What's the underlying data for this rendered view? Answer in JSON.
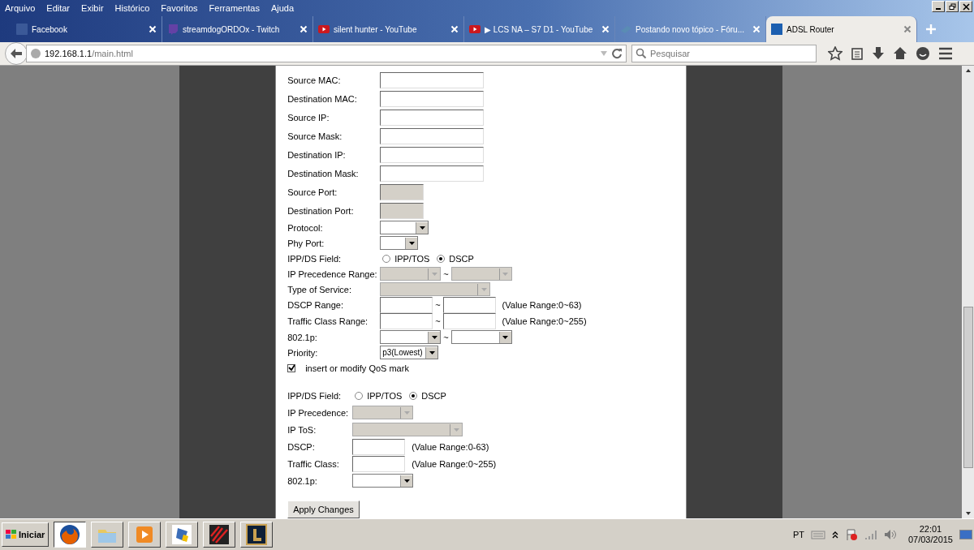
{
  "menu": [
    "Arquivo",
    "Editar",
    "Exibir",
    "Histórico",
    "Favoritos",
    "Ferramentas",
    "Ajuda"
  ],
  "tabs": [
    {
      "title": "Facebook",
      "selected": false
    },
    {
      "title": "streamdogORDOx - Twitch",
      "selected": false
    },
    {
      "title": "silent hunter - YouTube",
      "selected": false
    },
    {
      "title": "▶ LCS NA – S7 D1 - YouTube",
      "selected": false
    },
    {
      "title": "Postando novo tópico - Fóru...",
      "selected": false
    },
    {
      "title": "ADSL Router",
      "selected": true
    }
  ],
  "address": {
    "host": "192.168.1.1",
    "path": "/main.html"
  },
  "search": {
    "placeholder": "Pesquisar"
  },
  "sections": [
    {
      "rows": [
        {
          "kind": "controls",
          "label": "Source MAC:",
          "controls": [
            {
              "kind": "input",
              "disabled": false
            }
          ]
        },
        {
          "kind": "controls",
          "label": "Destination MAC:",
          "controls": [
            {
              "kind": "input",
              "disabled": false
            }
          ]
        },
        {
          "kind": "controls",
          "label": "Source IP:",
          "controls": [
            {
              "kind": "input",
              "disabled": false
            }
          ]
        },
        {
          "kind": "controls",
          "label": "Source Mask:",
          "controls": [
            {
              "kind": "input",
              "disabled": false
            }
          ]
        },
        {
          "kind": "controls",
          "label": "Destination IP:",
          "controls": [
            {
              "kind": "input",
              "disabled": false
            }
          ]
        },
        {
          "kind": "controls",
          "label": "Destination Mask:",
          "controls": [
            {
              "kind": "input",
              "disabled": false
            }
          ]
        },
        {
          "kind": "controls",
          "label": "Source Port:",
          "controls": [
            {
              "kind": "input",
              "disabled": true
            }
          ]
        },
        {
          "kind": "controls",
          "label": "Destination Port:",
          "controls": [
            {
              "kind": "input",
              "disabled": true
            }
          ]
        },
        {
          "kind": "controls",
          "label": "Protocol:",
          "controls": [
            {
              "kind": "select",
              "disabled": false
            }
          ]
        },
        {
          "kind": "controls",
          "label": "Phy Port:",
          "controls": [
            {
              "kind": "select",
              "disabled": false
            }
          ]
        },
        {
          "kind": "radio",
          "label": "IPP/DS Field:",
          "options": [
            {
              "label": "IPP/TOS",
              "selected": false
            },
            {
              "label": "DSCP",
              "selected": true
            }
          ]
        },
        {
          "kind": "controls",
          "label": "IP Precedence Range:",
          "separator": "~",
          "controls": [
            {
              "kind": "select",
              "disabled": true
            },
            {
              "kind": "select",
              "disabled": true
            }
          ]
        },
        {
          "kind": "controls",
          "label": "Type of Service:",
          "controls": [
            {
              "kind": "select",
              "disabled": true
            }
          ]
        },
        {
          "kind": "controls",
          "label": "DSCP Range:",
          "separator": "~",
          "hint": "(Value Range:0~63)",
          "controls": [
            {
              "kind": "input",
              "disabled": false
            },
            {
              "kind": "input",
              "disabled": false
            }
          ]
        },
        {
          "kind": "controls",
          "label": "Traffic Class Range:",
          "separator": "~",
          "hint": "(Value Range:0~255)",
          "controls": [
            {
              "kind": "input",
              "disabled": false
            },
            {
              "kind": "input",
              "disabled": false
            }
          ]
        },
        {
          "kind": "controls",
          "label": "802.1p:",
          "separator": "~",
          "controls": [
            {
              "kind": "select",
              "disabled": false
            },
            {
              "kind": "select",
              "disabled": false
            }
          ]
        },
        {
          "kind": "controls",
          "label": "Priority:",
          "controls": [
            {
              "kind": "select",
              "disabled": false,
              "value": "p3(Lowest)"
            }
          ]
        },
        {
          "kind": "checkbox",
          "label": "insert or modify QoS mark",
          "checked": true
        }
      ]
    },
    {
      "rows": [
        {
          "kind": "radio",
          "label": "IPP/DS Field:",
          "options": [
            {
              "label": "IPP/TOS",
              "selected": false
            },
            {
              "label": "DSCP",
              "selected": true
            }
          ]
        },
        {
          "kind": "controls",
          "label": "IP Precedence:",
          "controls": [
            {
              "kind": "select",
              "disabled": true
            }
          ]
        },
        {
          "kind": "controls",
          "label": "IP ToS:",
          "controls": [
            {
              "kind": "select",
              "disabled": true
            }
          ]
        },
        {
          "kind": "controls",
          "label": "DSCP:",
          "hint": "(Value Range:0-63)",
          "controls": [
            {
              "kind": "input",
              "disabled": false
            }
          ]
        },
        {
          "kind": "controls",
          "label": "Traffic Class:",
          "hint": "(Value Range:0~255)",
          "controls": [
            {
              "kind": "input",
              "disabled": false
            }
          ]
        },
        {
          "kind": "controls",
          "label": "802.1p:",
          "controls": [
            {
              "kind": "select",
              "disabled": false
            }
          ]
        }
      ]
    }
  ],
  "apply_button": "Apply Changes",
  "taskbar": {
    "start": "Iniciar",
    "apps": [
      {
        "selected": true
      },
      {
        "selected": false
      },
      {
        "selected": false
      },
      {
        "selected": false
      },
      {
        "selected": false
      },
      {
        "selected": false
      }
    ],
    "language": "PT",
    "time": "22:01",
    "date": "07/03/2015"
  }
}
